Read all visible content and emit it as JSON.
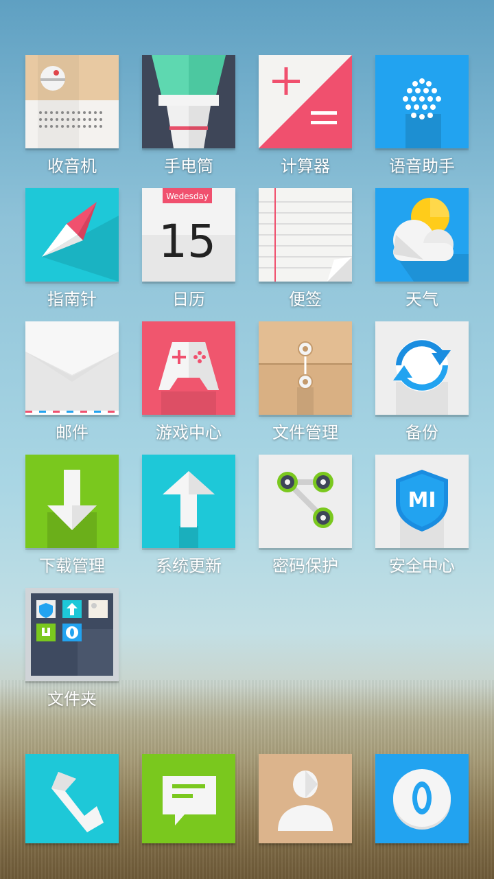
{
  "home": {
    "apps": [
      {
        "label": "收音机",
        "icon": "radio-icon"
      },
      {
        "label": "手电筒",
        "icon": "flashlight-icon"
      },
      {
        "label": "计算器",
        "icon": "calculator-icon"
      },
      {
        "label": "语音助手",
        "icon": "voice-assistant-icon"
      },
      {
        "label": "指南针",
        "icon": "compass-icon"
      },
      {
        "label": "日历",
        "icon": "calendar-icon",
        "weekday": "Wedesday",
        "day": "15"
      },
      {
        "label": "便签",
        "icon": "notes-icon"
      },
      {
        "label": "天气",
        "icon": "weather-icon"
      },
      {
        "label": "邮件",
        "icon": "mail-icon"
      },
      {
        "label": "游戏中心",
        "icon": "game-center-icon"
      },
      {
        "label": "文件管理",
        "icon": "file-manager-icon"
      },
      {
        "label": "备份",
        "icon": "backup-icon"
      },
      {
        "label": "下载管理",
        "icon": "download-manager-icon"
      },
      {
        "label": "系统更新",
        "icon": "system-update-icon"
      },
      {
        "label": "密码保护",
        "icon": "password-protect-icon"
      },
      {
        "label": "安全中心",
        "icon": "security-center-icon",
        "badge_text": "MI"
      },
      {
        "label": "文件夹",
        "icon": "folder-icon"
      }
    ]
  },
  "dock": {
    "apps": [
      {
        "icon": "phone-icon"
      },
      {
        "icon": "messages-icon"
      },
      {
        "icon": "contacts-icon"
      },
      {
        "icon": "browser-icon"
      }
    ]
  },
  "colors": {
    "cyan": "#1ec8d8",
    "green": "#7ac81e",
    "pink": "#f0506e",
    "blue": "#22a3f0",
    "tan": "#dcb48c"
  }
}
